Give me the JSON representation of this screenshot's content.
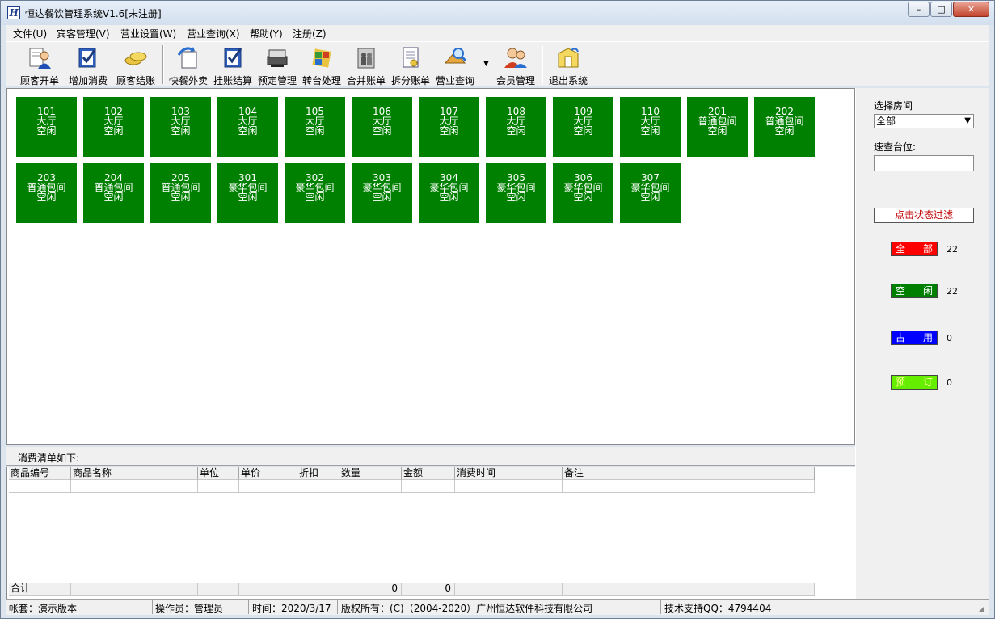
{
  "window": {
    "title": "恒达餐饮管理系统V1.6[未注册]",
    "icon_letter": "H",
    "buttons": {
      "minimize": "–",
      "maximize": "□",
      "close": "✕"
    }
  },
  "menu": [
    "文件(U)",
    "宾客管理(V)",
    "营业设置(W)",
    "营业查询(X)",
    "帮助(Y)",
    "注册(Z)"
  ],
  "toolbar": [
    {
      "label": "顾客开单",
      "icon": "customer-order-icon"
    },
    {
      "label": "增加消费",
      "icon": "add-consumption-icon"
    },
    {
      "label": "顾客结账",
      "icon": "checkout-coins-icon"
    },
    {
      "label": "快餐外卖",
      "icon": "takeaway-icon"
    },
    {
      "label": "挂账结算",
      "icon": "credit-settle-icon"
    },
    {
      "label": "预定管理",
      "icon": "reservation-icon"
    },
    {
      "label": "转台处理",
      "icon": "transfer-table-icon"
    },
    {
      "label": "合并账单",
      "icon": "merge-bill-icon"
    },
    {
      "label": "拆分账单",
      "icon": "split-bill-icon"
    },
    {
      "label": "营业查询",
      "icon": "business-query-icon"
    },
    {
      "label": "会员管理",
      "icon": "member-icon"
    },
    {
      "label": "退出系统",
      "icon": "exit-icon"
    }
  ],
  "rooms": [
    {
      "number": "101",
      "type": "大厅",
      "status": "空闲"
    },
    {
      "number": "102",
      "type": "大厅",
      "status": "空闲"
    },
    {
      "number": "103",
      "type": "大厅",
      "status": "空闲"
    },
    {
      "number": "104",
      "type": "大厅",
      "status": "空闲"
    },
    {
      "number": "105",
      "type": "大厅",
      "status": "空闲"
    },
    {
      "number": "106",
      "type": "大厅",
      "status": "空闲"
    },
    {
      "number": "107",
      "type": "大厅",
      "status": "空闲"
    },
    {
      "number": "108",
      "type": "大厅",
      "status": "空闲"
    },
    {
      "number": "109",
      "type": "大厅",
      "status": "空闲"
    },
    {
      "number": "110",
      "type": "大厅",
      "status": "空闲"
    },
    {
      "number": "201",
      "type": "普通包间",
      "status": "空闲"
    },
    {
      "number": "202",
      "type": "普通包间",
      "status": "空闲"
    },
    {
      "number": "203",
      "type": "普通包间",
      "status": "空闲"
    },
    {
      "number": "204",
      "type": "普通包间",
      "status": "空闲"
    },
    {
      "number": "205",
      "type": "普通包间",
      "status": "空闲"
    },
    {
      "number": "301",
      "type": "豪华包间",
      "status": "空闲"
    },
    {
      "number": "302",
      "type": "豪华包间",
      "status": "空闲"
    },
    {
      "number": "303",
      "type": "豪华包间",
      "status": "空闲"
    },
    {
      "number": "304",
      "type": "豪华包间",
      "status": "空闲"
    },
    {
      "number": "305",
      "type": "豪华包间",
      "status": "空闲"
    },
    {
      "number": "306",
      "type": "豪华包间",
      "status": "空闲"
    },
    {
      "number": "307",
      "type": "豪华包间",
      "status": "空闲"
    }
  ],
  "room_color": "#008000",
  "right_panel": {
    "select_room_label": "选择房间",
    "select_room_value": "全部",
    "quick_search_label": "速查台位:",
    "quick_search_value": "",
    "filter_button": "点击状态过滤",
    "statuses": [
      {
        "chars": [
          "全",
          "部"
        ],
        "count": "22",
        "color": "#ff0000",
        "text_color": "#ffffff"
      },
      {
        "chars": [
          "空",
          "闲"
        ],
        "count": "22",
        "color": "#008000",
        "text_color": "#ffffff"
      },
      {
        "chars": [
          "占",
          "用"
        ],
        "count": "0",
        "color": "#0000ff",
        "text_color": "#ffffff"
      },
      {
        "chars": [
          "预",
          "订"
        ],
        "count": "0",
        "color": "#66ee00",
        "text_color": "#ffff99"
      }
    ]
  },
  "order": {
    "title": "消费清单如下:",
    "columns": [
      "商品编号",
      "商品名称",
      "单位",
      "单价",
      "折扣",
      "数量",
      "金额",
      "消费时间",
      "备注"
    ],
    "total_label": "合计",
    "total_quantity": "0",
    "total_amount": "0"
  },
  "statusbar": {
    "account": "帐套：演示版本",
    "operator": "操作员：管理员",
    "time": "时间：2020/3/17",
    "copyright": "版权所有：(C)（2004-2020）广州恒达软件科技有限公司",
    "support": "技术支持QQ：4794404"
  }
}
